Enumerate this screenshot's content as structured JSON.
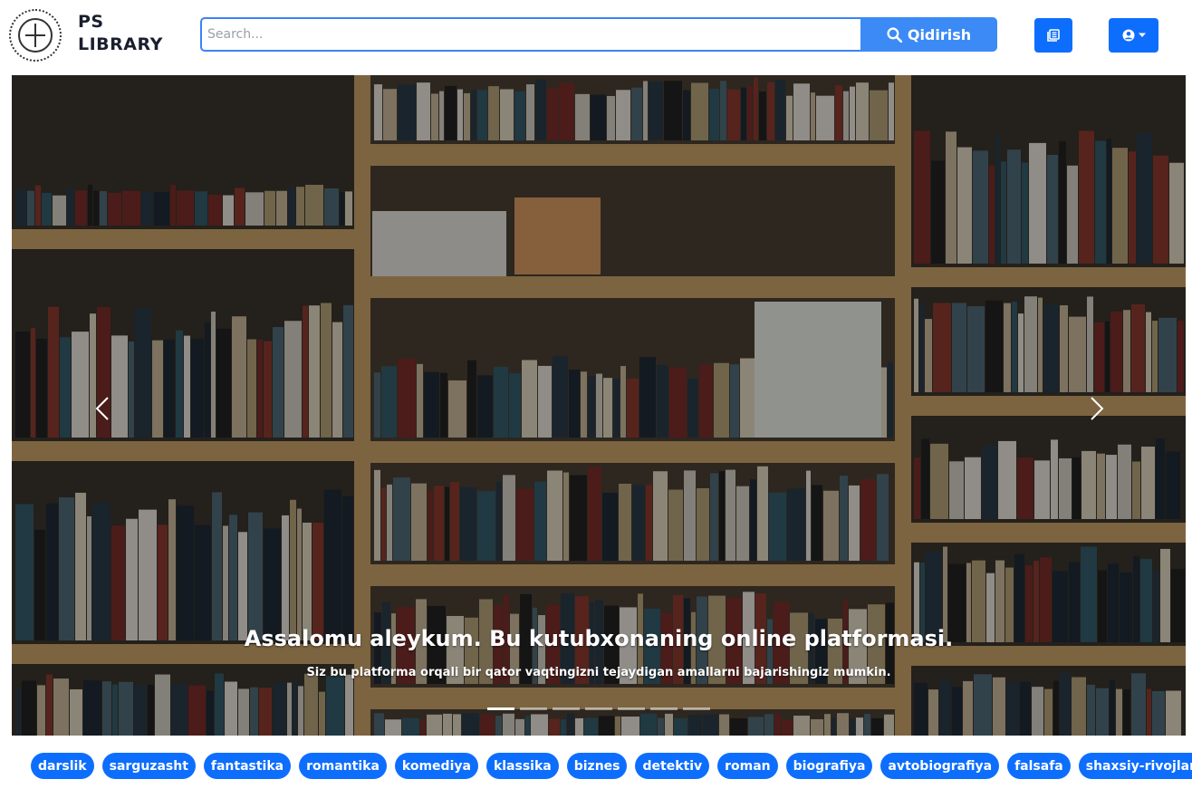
{
  "brand": {
    "line1": "PS",
    "line2": "LIBRARY"
  },
  "search": {
    "placeholder": "Search...",
    "value": "",
    "button_label": "Qidirish"
  },
  "navbar": {
    "books_icon": "books-icon",
    "user_icon": "user-circle-icon",
    "dropdown_icon": "caret-down-icon"
  },
  "carousel": {
    "title": "Assalomu aleykum. Bu kutubxonaning online platformasi.",
    "subtitle": "Siz bu platforma orqali bir qator vaqtingizni tejaydigan amallarni bajarishingiz mumkin.",
    "slide_count": 7,
    "active_slide": 1,
    "prev_icon": "chevron-left-icon",
    "next_icon": "chevron-right-icon"
  },
  "categories": [
    "darslik",
    "sarguzasht",
    "fantastika",
    "romantika",
    "komediya",
    "klassika",
    "biznes",
    "detektiv",
    "roman",
    "biografiya",
    "avtobiografiya",
    "falsafa",
    "shaxsiy-rivojlanish"
  ],
  "colors": {
    "primary": "#0d6efd",
    "search_button": "#3b8af6",
    "search_border": "#3b82f6"
  }
}
